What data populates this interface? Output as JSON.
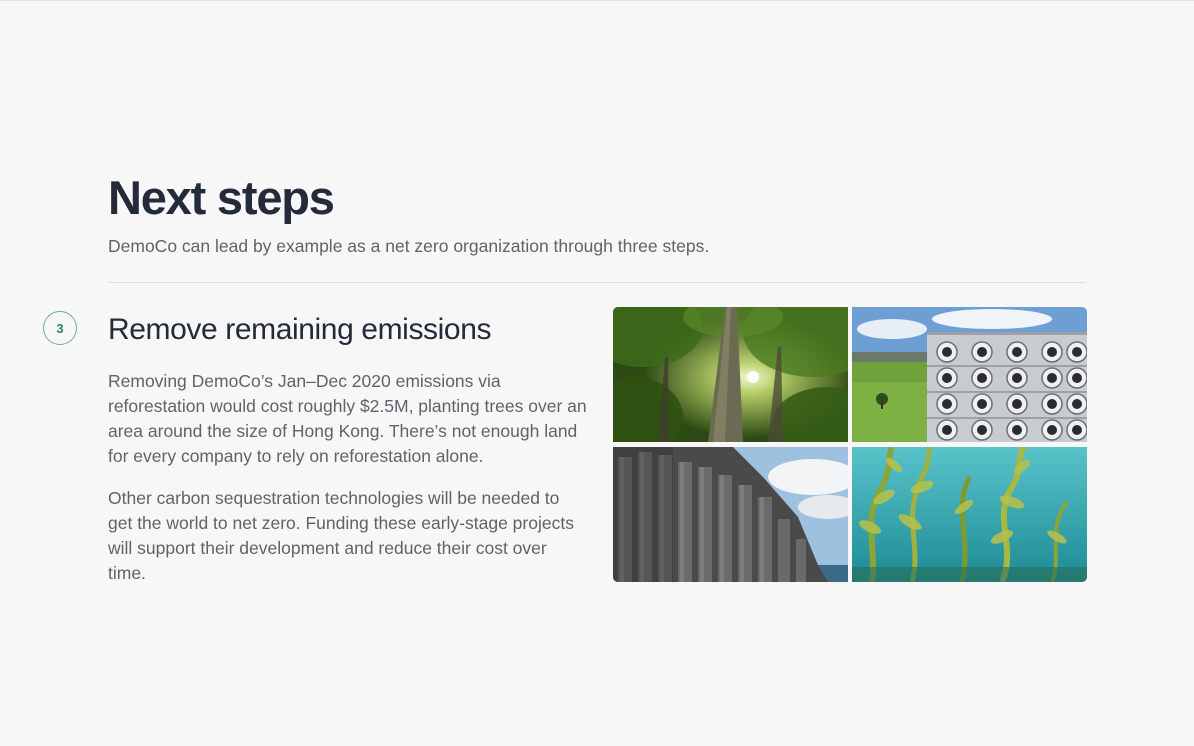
{
  "header": {
    "title": "Next steps",
    "subtitle": "DemoCo can lead by example as a net zero organization through three steps."
  },
  "step": {
    "number": "3",
    "heading": "Remove remaining emissions",
    "paragraphs": [
      "Removing DemoCo’s Jan–Dec 2020 emissions via reforestation would cost roughly $2.5M, planting trees over an area around the size of Hong Kong. There’s not enough land for every company to rely on reforestation alone.",
      "Other carbon sequestration technologies will be needed to get the world to net zero. Funding these early-stage projects will support their development and reduce their cost over time."
    ]
  },
  "images": [
    {
      "subject": "forest-canopy"
    },
    {
      "subject": "direct-air-capture-fans"
    },
    {
      "subject": "basalt-columns"
    },
    {
      "subject": "kelp-forest"
    }
  ],
  "colors": {
    "background": "#f7f7f7",
    "heading": "#232a3a",
    "body_text": "#5f6368",
    "accent": "#2e7f74"
  }
}
